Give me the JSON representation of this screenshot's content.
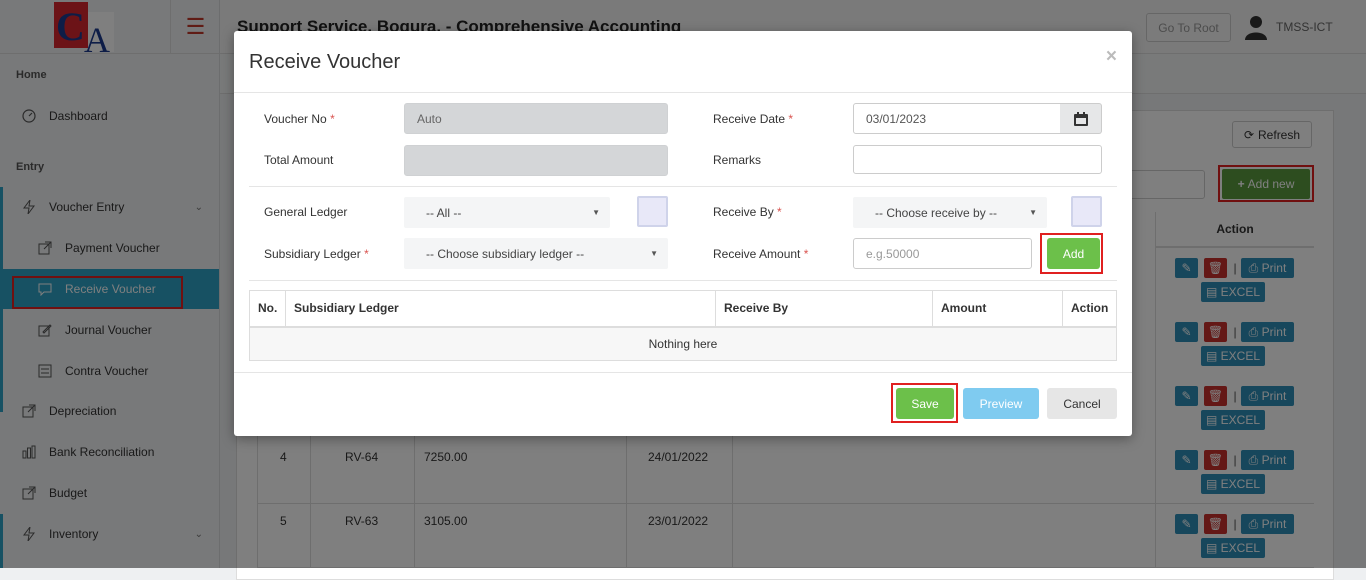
{
  "header": {
    "title": "Support Service, Bogura. - Comprehensive Accounting",
    "goto_root": "Go To Root",
    "user": "TMSS-ICT"
  },
  "sidebar": {
    "home_section": "Home",
    "dashboard": "Dashboard",
    "entry_section": "Entry",
    "voucher_entry": "Voucher Entry",
    "payment_voucher": "Payment Voucher",
    "receive_voucher": "Receive Voucher",
    "journal_voucher": "Journal Voucher",
    "contra_voucher": "Contra Voucher",
    "depreciation": "Depreciation",
    "bank_reconciliation": "Bank Reconciliation",
    "budget": "Budget",
    "inventory": "Inventory"
  },
  "page": {
    "refresh": "Refresh",
    "add_new": "Add new",
    "action_header": "Action",
    "edit_glyph": "✎",
    "delete_glyph": "🗑",
    "print": "Print",
    "excel": "EXCEL",
    "rows": [
      {
        "no": "4",
        "voucher": "RV-64",
        "amount": "7250.00",
        "date": "24/01/2022"
      },
      {
        "no": "5",
        "voucher": "RV-63",
        "amount": "3105.00",
        "date": "23/01/2022"
      }
    ]
  },
  "modal": {
    "title": "Receive Voucher",
    "close": "×",
    "voucher_no_label": "Voucher No",
    "voucher_no_value": "Auto",
    "receive_date_label": "Receive Date",
    "receive_date_value": "03/01/2023",
    "total_amount_label": "Total Amount",
    "total_amount_value": "",
    "remarks_label": "Remarks",
    "remarks_value": "",
    "general_ledger_label": "General Ledger",
    "general_ledger_value": "-- All --",
    "receive_by_label": "Receive By",
    "receive_by_value": "-- Choose receive by --",
    "subsidiary_ledger_label": "Subsidiary Ledger",
    "subsidiary_ledger_value": "-- Choose subsidiary ledger --",
    "receive_amount_label": "Receive Amount",
    "receive_amount_placeholder": "e.g.50000",
    "add": "Add",
    "table": {
      "headers": [
        "No.",
        "Subsidiary Ledger",
        "Receive By",
        "Amount",
        "Action"
      ],
      "empty": "Nothing here"
    },
    "save": "Save",
    "preview": "Preview",
    "cancel": "Cancel",
    "required_mark": "*"
  },
  "colors": {
    "accent": "#2ea3c7",
    "success": "#6cc04a",
    "danger": "#c9302c",
    "highlight": "#e02020"
  }
}
